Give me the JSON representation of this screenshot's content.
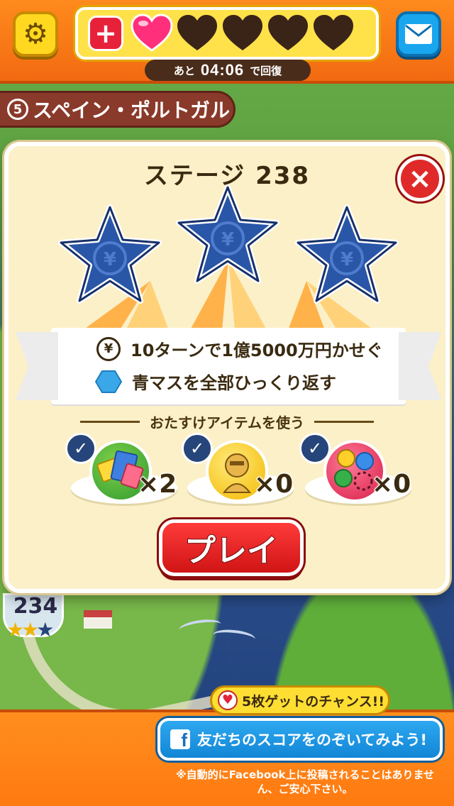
{
  "header": {
    "add_heart_label": "+",
    "hearts": [
      {
        "state": "full",
        "color": "#ff2f7c"
      },
      {
        "state": "empty",
        "color": "#3a2418"
      },
      {
        "state": "empty",
        "color": "#3a2418"
      },
      {
        "state": "empty",
        "color": "#3a2418"
      },
      {
        "state": "empty",
        "color": "#3a2418"
      }
    ],
    "timer_prefix": "あと",
    "timer_value": "04:06",
    "timer_suffix": "で回復",
    "settings_icon": "gear-icon",
    "mail_icon": "mail-icon"
  },
  "area": {
    "number": "5",
    "name": "スペイン・ポルトガル"
  },
  "dialog": {
    "title": "ステージ 238",
    "close_label": "×",
    "stars_earned": 0,
    "stars_total": 3,
    "star_symbol": "¥",
    "goals": [
      {
        "icon": "yen-icon",
        "icon_text": "¥",
        "text": "10ターンで1億5000万円かせぐ"
      },
      {
        "icon": "blue-hexagon-icon",
        "text": "青マスを全部ひっくり返す"
      }
    ],
    "items_header": "おたすけアイテムを使う",
    "items": [
      {
        "name": "cash-bundle",
        "count": "×2",
        "checked": true,
        "color": "#2f9a2f"
      },
      {
        "name": "golden-statue",
        "count": "×0",
        "checked": true,
        "color": "#f3b900"
      },
      {
        "name": "coin-set",
        "count": "×0",
        "checked": true,
        "color": "#e0264f"
      }
    ],
    "play_label": "プレイ"
  },
  "map": {
    "stage_number": "234",
    "stage_stars": [
      "★",
      "★",
      "★"
    ],
    "stage_stars_earned": 2
  },
  "footer": {
    "chance_text": "5枚ゲットのチャンス!!",
    "fb_icon_text": "f",
    "fb_button_text": "友だちのスコアをのぞいてみよう!",
    "fb_note": "※自動的にFacebook上に投稿されることはありません、ご安心下さい。"
  },
  "colors": {
    "orange_band": "#ff7a10",
    "dialog_bg": "#fbf0c8",
    "star_blue": "#2a56a8",
    "play_red": "#e01e1e",
    "fb_blue": "#1a93e0"
  }
}
